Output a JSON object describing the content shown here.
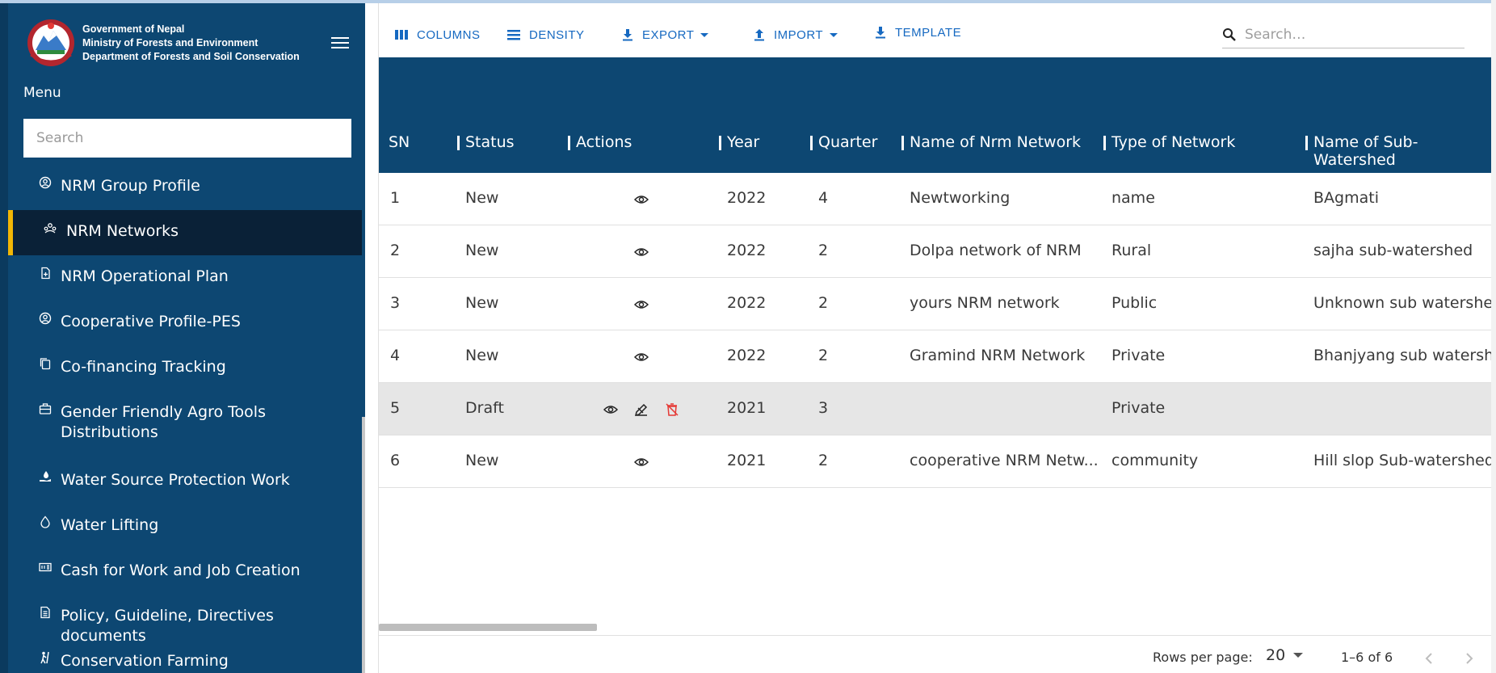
{
  "brand": {
    "line1": "Government of Nepal",
    "line2": "Ministry of Forests and Environment",
    "line3": "Department of Forests and Soil Conservation"
  },
  "sidebar": {
    "menu_label": "Menu",
    "search_placeholder": "Search",
    "items": [
      {
        "label": "NRM Group Profile",
        "icon": "user-circle-icon"
      },
      {
        "label": "NRM Networks",
        "icon": "network-icon"
      },
      {
        "label": "NRM Operational Plan",
        "icon": "document-plus-icon"
      },
      {
        "label": "Cooperative Profile-PES",
        "icon": "user-circle-icon"
      },
      {
        "label": "Co-financing Tracking",
        "icon": "copy-icon"
      },
      {
        "label": "Gender Friendly Agro Tools Distributions",
        "icon": "toolbox-icon"
      },
      {
        "label": "Water Source Protection Work",
        "icon": "hand-drop-icon"
      },
      {
        "label": "Water Lifting",
        "icon": "water-drop-icon"
      },
      {
        "label": "Cash for Work and Job Creation",
        "icon": "cash-icon"
      },
      {
        "label": "Policy, Guideline, Directives documents",
        "icon": "document-icon"
      },
      {
        "label": "Conservation Farming",
        "icon": "farmer-icon"
      }
    ],
    "active_index": 1
  },
  "toolbar": {
    "columns": "COLUMNS",
    "density": "DENSITY",
    "export": "EXPORT",
    "import": "IMPORT",
    "template": "TEMPLATE",
    "search_placeholder": "Search…"
  },
  "table": {
    "columns": [
      "SN",
      "Status",
      "Actions",
      "Year",
      "Quarter",
      "Name of Nrm Network",
      "Type of Network",
      "Name of Sub-Watershed"
    ],
    "rows": [
      {
        "sn": "1",
        "status": "New",
        "year": "2022",
        "quarter": "4",
        "name": "Newtworking",
        "type": "name",
        "sub": "BAgmati"
      },
      {
        "sn": "2",
        "status": "New",
        "year": "2022",
        "quarter": "2",
        "name": "Dolpa network of NRM",
        "type": "Rural",
        "sub": "sajha sub-watershed"
      },
      {
        "sn": "3",
        "status": "New",
        "year": "2022",
        "quarter": "2",
        "name": "yours NRM network",
        "type": "Public",
        "sub": "Unknown sub watershed"
      },
      {
        "sn": "4",
        "status": "New",
        "year": "2022",
        "quarter": "2",
        "name": "Gramind NRM Network",
        "type": "Private",
        "sub": "Bhanjyang sub watershe"
      },
      {
        "sn": "5",
        "status": "Draft",
        "year": "2021",
        "quarter": "3",
        "name": "",
        "type": "Private",
        "sub": ""
      },
      {
        "sn": "6",
        "status": "New",
        "year": "2021",
        "quarter": "2",
        "name": "cooperative NRM Netw...",
        "type": "community",
        "sub": "Hill slop Sub-watershed"
      }
    ]
  },
  "footer": {
    "rows_per_page_label": "Rows per page:",
    "rows_per_page_value": "20",
    "range": "1–6 of 6"
  },
  "colors": {
    "primary": "#0d4772",
    "accent": "#f2b705",
    "link": "#1669c1",
    "delete": "#e53935"
  }
}
